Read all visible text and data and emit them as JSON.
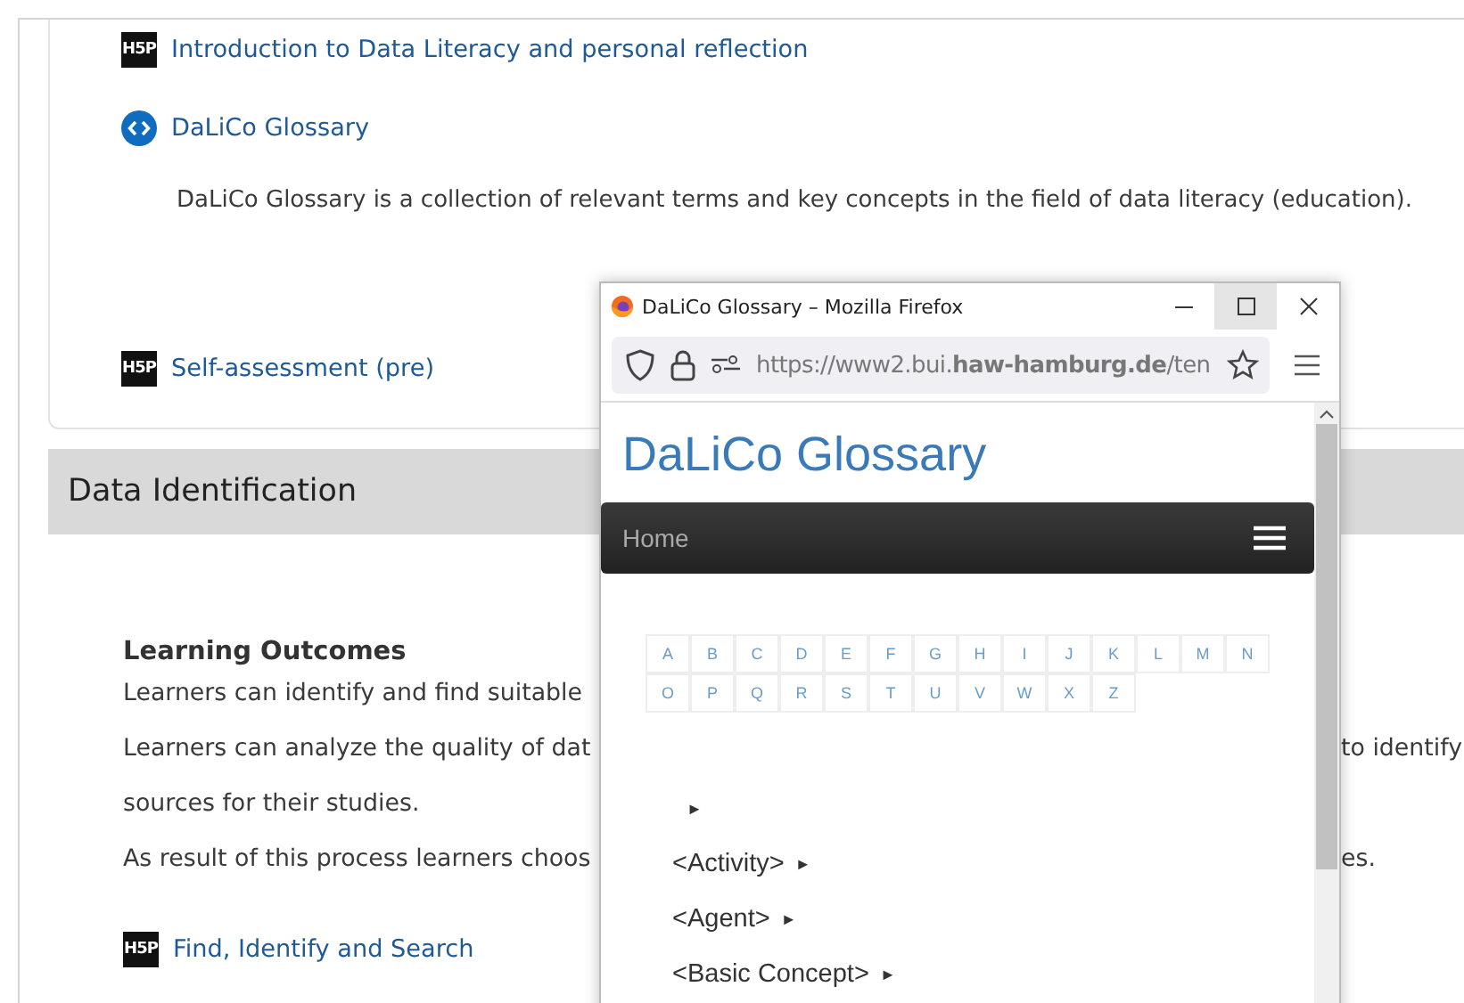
{
  "course_items": [
    {
      "kind": "h5p",
      "logo": "H5P",
      "title": "Introduction to Data Literacy and personal reflection"
    },
    {
      "kind": "embed",
      "title": "DaLiCo Glossary",
      "description": "DaLiCo Glossary is a collection of relevant terms and key concepts in the field of data literacy (education)."
    },
    {
      "kind": "h5p",
      "logo": "H5P",
      "title": "Self-assessment (pre)"
    }
  ],
  "section": {
    "title": "Data Identification",
    "heading": "Learning Outcomes",
    "lines": [
      {
        "left": "Learners can identify and find suitable"
      },
      {
        "left": "Learners can analyze the quality of dat",
        "right": "to identify"
      },
      {
        "left": "sources for their studies."
      },
      {
        "left": "As result of this process learners choos",
        "right": "es."
      }
    ],
    "items": [
      {
        "kind": "h5p",
        "logo": "H5P",
        "title": "Find, Identify and Search"
      }
    ]
  },
  "popup": {
    "title": "DaLiCo Glossary – Mozilla Firefox",
    "url": "https://www2.bui.**haw-hamburg.de**/ten",
    "page_title": "DaLiCo Glossary",
    "nav_label": "Home",
    "letters": [
      [
        "A",
        "B",
        "C",
        "D",
        "E",
        "F",
        "G",
        "H",
        "I",
        "J",
        "K",
        "L",
        "M",
        "N"
      ],
      [
        "O",
        "P",
        "Q",
        "R",
        "S",
        "T",
        "U",
        "V",
        "W",
        "X",
        "Z"
      ]
    ],
    "tree": [
      {
        "arrow": "►"
      },
      {
        "label": "<Activity>",
        "arrow": "►"
      },
      {
        "label": "<Agent>",
        "arrow": "►"
      },
      {
        "label": "<Basic Concept>",
        "arrow": "►"
      }
    ]
  }
}
